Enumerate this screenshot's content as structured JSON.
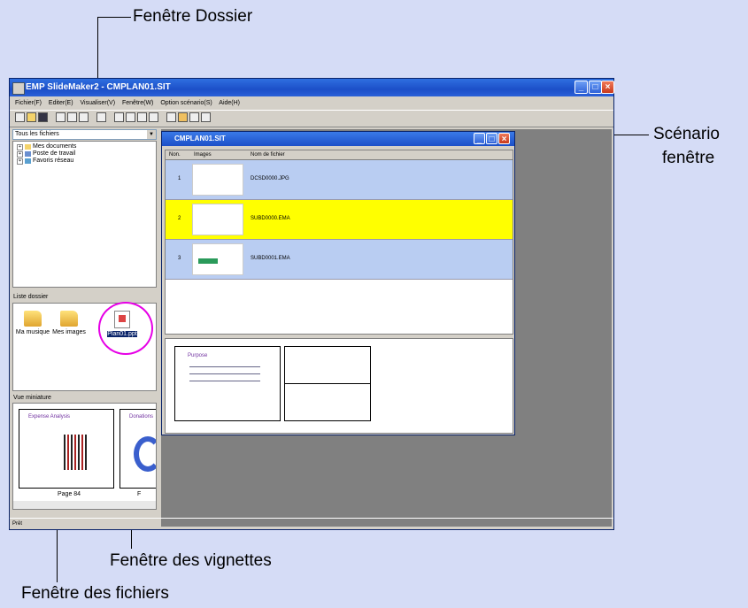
{
  "callouts": {
    "folder_window": "Fenêtre Dossier",
    "scenario_window_1": "Scénario",
    "scenario_window_2": "fenêtre",
    "thumbnail_window": "Fenêtre des vignettes",
    "file_window": "Fenêtre des fichiers"
  },
  "app": {
    "title": "EMP SlideMaker2 - CMPLAN01.SIT",
    "menu": [
      "Fichier(F)",
      "Editer(E)",
      "Visualiser(V)",
      "Fenêtre(W)",
      "Option scénario(S)",
      "Aide(H)"
    ],
    "status": "Prêt"
  },
  "folder_panel": {
    "selector": "Tous les fichiers",
    "tree": [
      "Mes documents",
      "Poste de travail",
      "Favoris réseau"
    ]
  },
  "file_list": {
    "title": "Liste dossier",
    "items": [
      "Ma musique",
      "Mes images",
      "Plan01.ppt"
    ]
  },
  "thumbnail_panel": {
    "title": "Vue miniature",
    "slide_title": "Expense Analysis",
    "slide_title_2": "Donations",
    "page_label": "Page 84",
    "page_label_2": "F"
  },
  "scenario": {
    "title": "CMPLAN01.SIT",
    "columns": [
      "Non.",
      "Images",
      "Nom de fichier"
    ],
    "rows": [
      {
        "num": "1",
        "file": "DCSD0000.JPG",
        "color": "#b9cdf2"
      },
      {
        "num": "2",
        "file": "SUBD0000.EMA",
        "color": "#ffff00"
      },
      {
        "num": "3",
        "file": "SUBD0001.EMA",
        "color": "#b9cdf2"
      }
    ],
    "preview_title": "Purpose"
  },
  "colors": {
    "background": "#d5dcf6",
    "highlight_circle": "#e600e6",
    "selected_row": "#ffff00",
    "row": "#b9cdf2"
  }
}
